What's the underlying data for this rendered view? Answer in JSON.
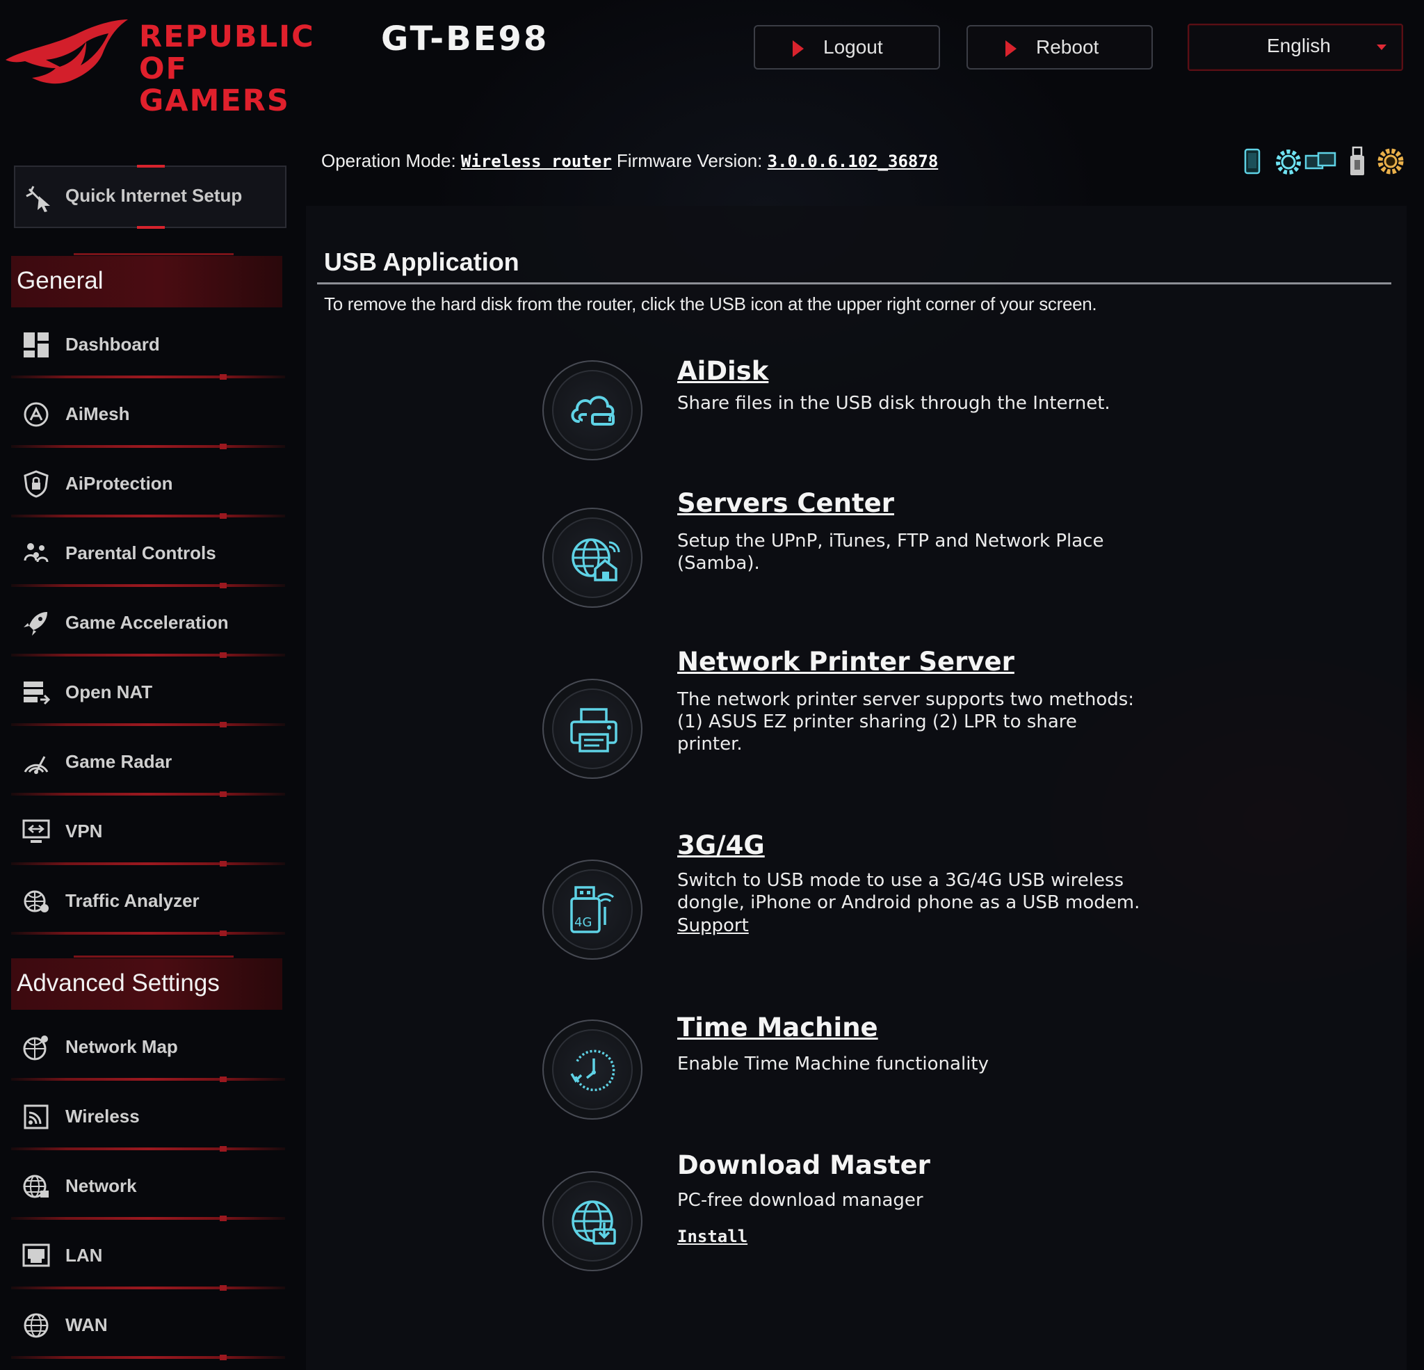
{
  "header": {
    "brand_line1": "Republic of",
    "brand_line2": "Gamers",
    "model": "GT-BE98",
    "logout_label": "Logout",
    "reboot_label": "Reboot",
    "language": "English"
  },
  "status": {
    "op_mode_label": "Operation Mode:",
    "op_mode_value": "Wireless router",
    "fw_label": "Firmware Version:",
    "fw_value": "3.0.0.6.102_36878",
    "icons": [
      "phone-icon",
      "settings-gear-icon",
      "network-clients-icon",
      "usb-icon",
      "system-settings-icon"
    ]
  },
  "sidebar": {
    "quick_setup": "Quick Internet Setup",
    "general_heading": "General",
    "general_items": [
      {
        "label": "Dashboard",
        "icon": "dashboard-icon"
      },
      {
        "label": "AiMesh",
        "icon": "aimesh-icon"
      },
      {
        "label": "AiProtection",
        "icon": "shield-lock-icon"
      },
      {
        "label": "Parental Controls",
        "icon": "family-icon"
      },
      {
        "label": "Game Acceleration",
        "icon": "rocket-icon"
      },
      {
        "label": "Open NAT",
        "icon": "open-nat-icon"
      },
      {
        "label": "Game Radar",
        "icon": "radar-icon"
      },
      {
        "label": "VPN",
        "icon": "vpn-monitor-icon"
      },
      {
        "label": "Traffic Analyzer",
        "icon": "traffic-analyzer-icon"
      }
    ],
    "advanced_heading": "Advanced Settings",
    "advanced_items": [
      {
        "label": "Network Map",
        "icon": "network-map-icon"
      },
      {
        "label": "Wireless",
        "icon": "wireless-icon"
      },
      {
        "label": "Network",
        "icon": "globe-icon"
      },
      {
        "label": "LAN",
        "icon": "lan-icon"
      },
      {
        "label": "WAN",
        "icon": "wan-globe-icon"
      }
    ]
  },
  "main": {
    "title": "USB Application",
    "hint": "To remove the hard disk from the router, click the USB icon at the upper right corner of your screen.",
    "apps": [
      {
        "name": "AiDisk",
        "icon": "cloud-disk-icon",
        "desc_lines": [
          "Share files in the USB disk through the Internet."
        ]
      },
      {
        "name": "Servers Center",
        "icon": "globe-home-icon",
        "desc_lines": [
          "Setup the UPnP, iTunes, FTP and Network Place",
          "(Samba)."
        ]
      },
      {
        "name": "Network Printer Server",
        "icon": "printer-icon",
        "desc_lines": [
          "The network printer server supports two methods:",
          "(1) ASUS EZ printer sharing (2) LPR to share",
          "printer."
        ]
      },
      {
        "name": "3G/4G",
        "icon": "usb-4g-modem-icon",
        "desc_lines": [
          "Switch to USB mode to use a 3G/4G USB wireless",
          "dongle, iPhone or Android phone as a USB modem."
        ],
        "link": "Support"
      },
      {
        "name": "Time Machine",
        "icon": "clock-icon",
        "desc_lines": [
          "Enable Time Machine functionality"
        ]
      },
      {
        "name": "Download Master",
        "icon": "globe-download-icon",
        "desc_lines": [
          "PC-free download manager"
        ],
        "link": "Install"
      }
    ]
  },
  "colors": {
    "accent_red": "#d9232d",
    "icon_cyan": "#5fd3e6",
    "background": "#07080c"
  }
}
